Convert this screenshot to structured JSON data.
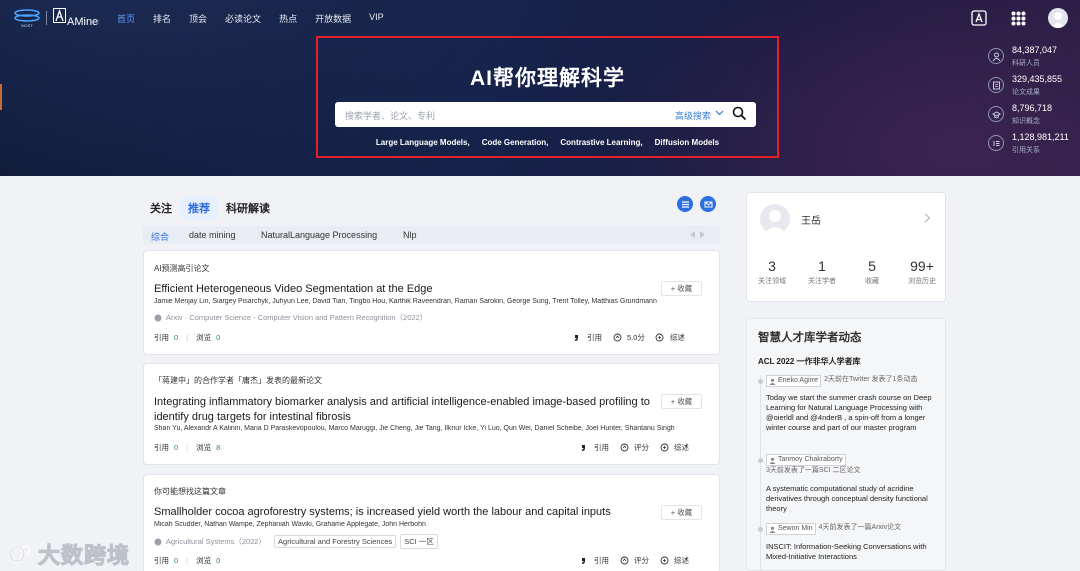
{
  "nav": {
    "logo_text": "AMiner",
    "items": [
      {
        "label": "首页",
        "active": true
      },
      {
        "label": "排名",
        "active": false
      },
      {
        "label": "顶会",
        "active": false
      },
      {
        "label": "必读论文",
        "active": false
      },
      {
        "label": "热点",
        "active": false
      },
      {
        "label": "开放数据",
        "active": false
      },
      {
        "label": "VIP",
        "active": false
      }
    ]
  },
  "hero": {
    "title": "AI帮你理解科学",
    "search_placeholder": "搜索学者、论文、专利",
    "advanced_search": "高级搜索",
    "hot_keywords": [
      "Large Language Models,",
      "Code Generation,",
      "Contrastive Learning,",
      "Diffusion Models"
    ]
  },
  "stats": [
    {
      "value": "84,387,047",
      "label": "科研人员",
      "icon": "person-icon"
    },
    {
      "value": "329,435,855",
      "label": "论文成果",
      "icon": "document-icon"
    },
    {
      "value": "8,796,718",
      "label": "知识概念",
      "icon": "concept-icon"
    },
    {
      "value": "1,128,981,211",
      "label": "引用关系",
      "icon": "citation-icon"
    }
  ],
  "feed": {
    "tabs": [
      {
        "label": "关注",
        "active": false
      },
      {
        "label": "推荐",
        "active": true
      },
      {
        "label": "科研解读",
        "active": false
      }
    ],
    "subtabs": [
      {
        "label": "综合",
        "active": true
      },
      {
        "label": "date mining",
        "active": false
      },
      {
        "label": "NaturalLanguage Processing",
        "active": false
      },
      {
        "label": "Nlp",
        "active": false
      }
    ]
  },
  "papers": [
    {
      "reason": "AI预测高引论文",
      "title": "Efficient Heterogeneous Video Segmentation at the Edge",
      "authors": "Jamie Menjay Lin, Siargey Pisarchyk, Juhyun Lee, David Tian, Tingbo Hou, Karthik Raveendran, Raman Sarokin, George Sung, Trent Tolley, Matthias Grundmann",
      "venue": "Arxiv · Computer Science - Computer Vision and Pattern Recognition（2022）",
      "tags": [],
      "collect": "收藏",
      "cite_label": "引用",
      "cite_value": "0",
      "view_label": "浏览",
      "view_value": "0",
      "act_cite": "引用",
      "act_score": "5.0分",
      "act_summary": "综述"
    },
    {
      "reason": "「蒋建中」的合作学者「庸杰」发表的最新论文",
      "title": "Integrating inflammatory biomarker analysis and artificial intelligence-enabled image-based profiling to identify drug targets for intestinal fibrosis",
      "authors": "Shan Yu, Alexandr A Kalinin, Maria D Paraskevopoulou, Marco Maruggi, Jie Cheng, Jie Tang, Ilknur Icke, Yi Luo, Qun Wei, Daniel Scheibe, Joel Hunter, Shantanu Singh",
      "venue": "",
      "tags": [],
      "collect": "收藏",
      "cite_label": "引用",
      "cite_value": "0",
      "view_label": "浏览",
      "view_value": "8",
      "act_cite": "引用",
      "act_score": "评分",
      "act_summary": "综述"
    },
    {
      "reason": "你可能想找这篇文章",
      "title": "Smallholder cocoa agroforestry systems; is increased yield worth the labour and capital inputs",
      "authors": "Micah Scudder, Nathan Wampe, Zephaniah Waviki, Grahame Applegate, John Herbohn",
      "venue": "Agricultural Systems（2022）",
      "tags": [
        "Agricultural and Forestry Sciences",
        "SCI 一区"
      ],
      "collect": "收藏",
      "cite_label": "引用",
      "cite_value": "0",
      "view_label": "浏览",
      "view_value": "0",
      "act_cite": "引用",
      "act_score": "评分",
      "act_summary": "综述"
    }
  ],
  "profile": {
    "name": "王岳",
    "counts": [
      {
        "value": "3",
        "label": "关注领域"
      },
      {
        "value": "1",
        "label": "关注学者"
      },
      {
        "value": "5",
        "label": "收藏"
      },
      {
        "value": "99+",
        "label": "浏览历史"
      }
    ]
  },
  "talent": {
    "title": "智慧人才库学者动态",
    "subtitle": "ACL 2022 一作非华人学者库",
    "items": [
      {
        "user": "Eneko Agirre",
        "meta": "2天前在Twitter 发表了1条动态",
        "text": "Today we start the summer crash course on Deep Learning for Natural Language Processing with @oierldl and @4nderB , a spin-off from a longer winter course and part of our master program"
      },
      {
        "user": "Tanmoy Chakraborty",
        "meta": "3天前发表了一篇SCI 二区论文",
        "text": "A systematic computational study of acridine derivatives through conceptual density functional theory"
      },
      {
        "user": "Sewon Min",
        "meta": "4天前发表了一篇Arxiv论文",
        "text": "INSCIT: Information-Seeking Conversations with Mixed-Initiative Interactions"
      }
    ]
  },
  "watermark": "大数跨境",
  "colors": {
    "accent": "#2e6fe0",
    "highlight_box": "#e5202a",
    "hero_bg": "#15224a"
  }
}
